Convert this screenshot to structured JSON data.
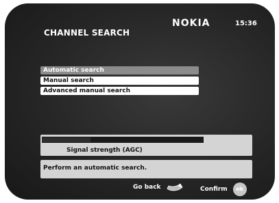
{
  "header": {
    "title": "CHANNEL SEARCH",
    "brand": "NOKIA",
    "time": "15:36"
  },
  "menu": {
    "items": [
      {
        "label": "Automatic search",
        "selected": true
      },
      {
        "label": "Manual search",
        "selected": false
      },
      {
        "label": "Advanced manual search",
        "selected": false
      }
    ]
  },
  "signal": {
    "label": "Signal strength (AGC)",
    "level_fraction": 0.3
  },
  "info": {
    "text": "Perform an automatic search."
  },
  "footer": {
    "back_label": "Go back",
    "back_icon": "back-arrow-icon",
    "confirm_label": "Confirm",
    "ok_label": "ok"
  },
  "colors": {
    "background": "#262626",
    "selected_item": "#8c8c8c",
    "panel": "#d4d4d4"
  }
}
